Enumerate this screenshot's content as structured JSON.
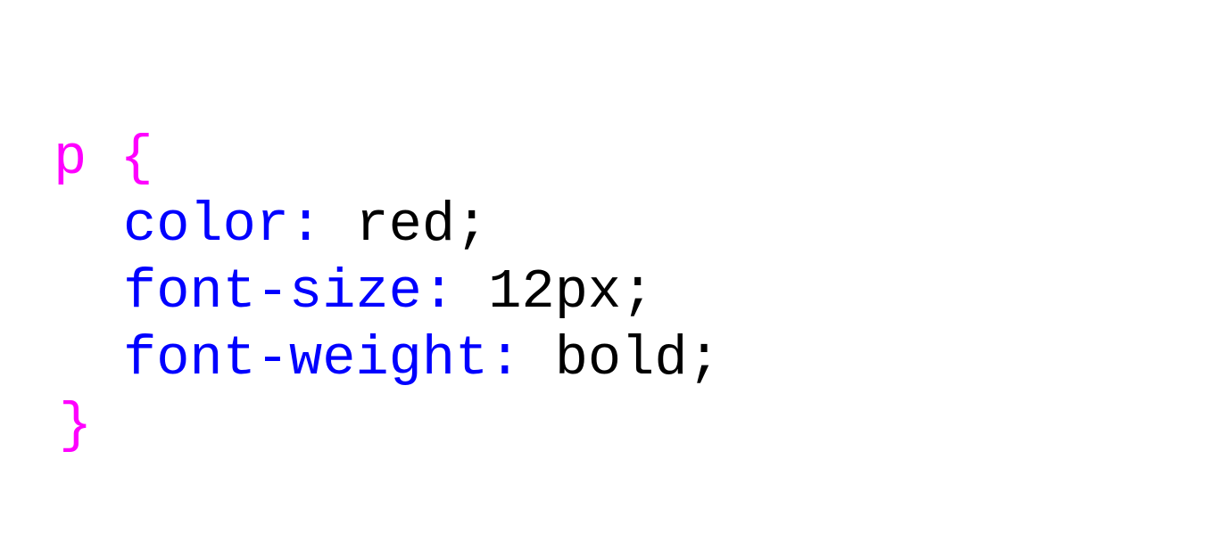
{
  "code": {
    "selector": "p",
    "open_brace": "{",
    "close_brace": "}",
    "declarations": [
      {
        "property": "color",
        "colon": ":",
        "value": "red",
        "semicolon": ";"
      },
      {
        "property": "font-size",
        "colon": ":",
        "value": "12px",
        "semicolon": ";"
      },
      {
        "property": "font-weight",
        "colon": ":",
        "value": "bold",
        "semicolon": ";"
      }
    ]
  },
  "colors": {
    "selector": "#ff00ff",
    "property": "#0000ff",
    "value": "#000000",
    "highlight": "#ffff00"
  }
}
